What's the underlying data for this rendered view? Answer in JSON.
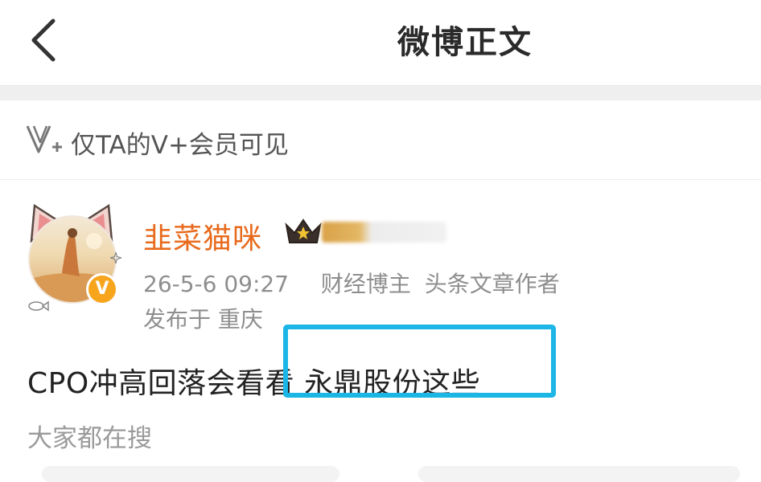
{
  "header": {
    "title": "微博正文",
    "back_icon": "chevron-left-icon"
  },
  "visibility": {
    "icon": "v-plus-icon",
    "text": "仅TA的V+会员可见"
  },
  "post": {
    "author": {
      "name": "韭菜猫咪",
      "verified_badge": "V",
      "name_color": "#e86a1c"
    },
    "timestamp": "26-5-6 09:27",
    "tags": [
      "财经博主",
      "头条文章作者"
    ],
    "location": "发布于 重庆",
    "content": "CPO冲高回落会看看 永鼎股份这些"
  },
  "search": {
    "label": "大家都在搜"
  },
  "colors": {
    "highlight_border": "#1bb5e6",
    "badge_orange": "#f7a51d"
  }
}
